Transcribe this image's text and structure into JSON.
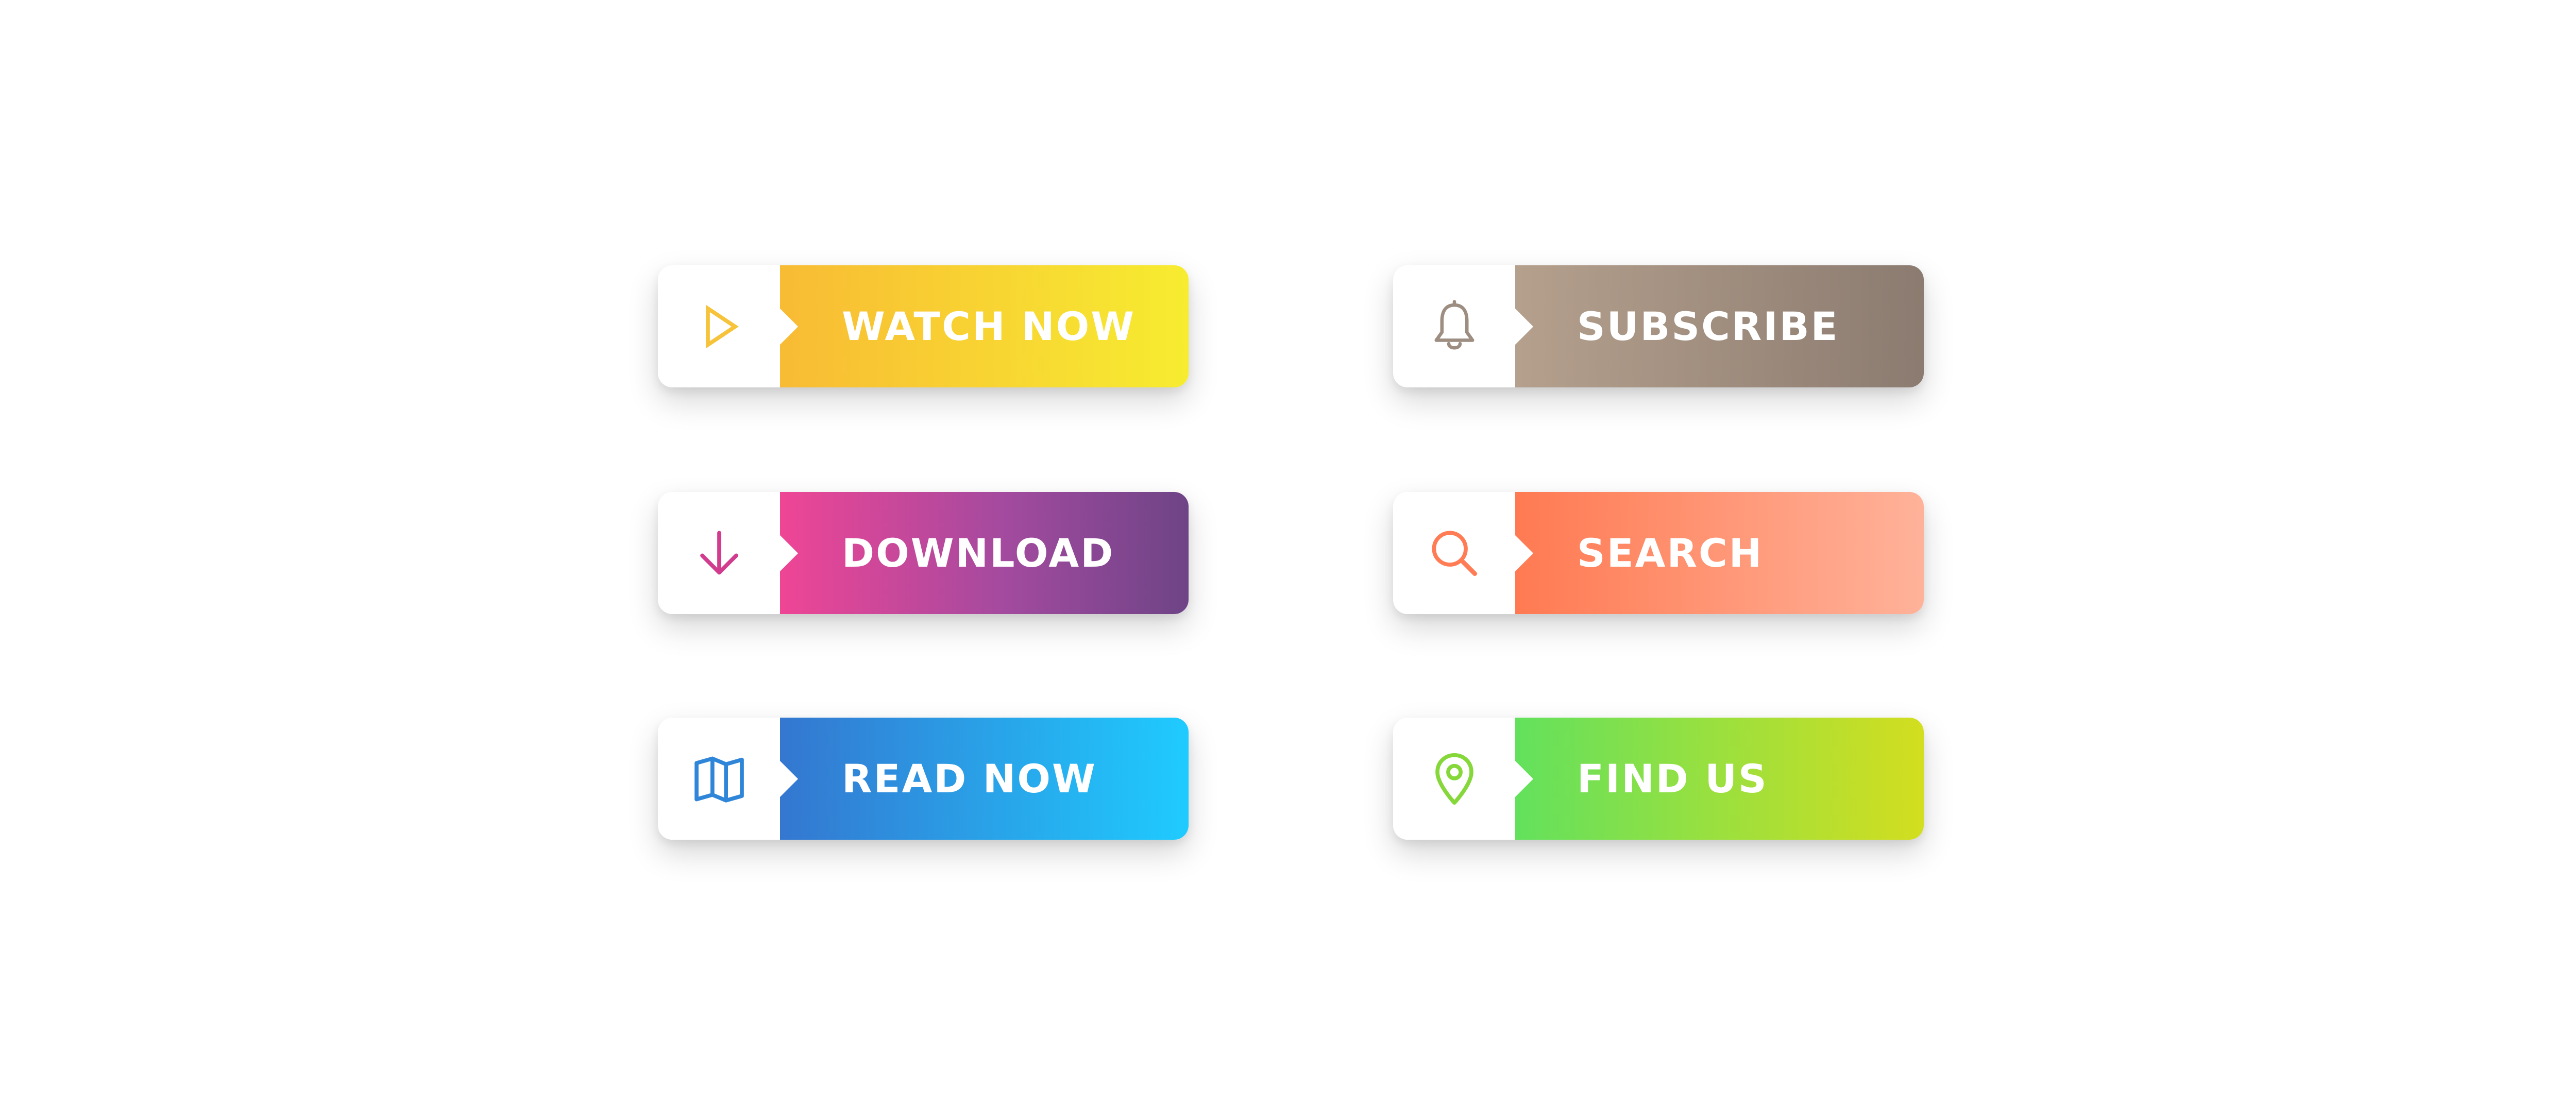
{
  "buttons": {
    "watch_now": {
      "label": "WATCH NOW",
      "icon": "play-icon",
      "gradient_from": "#F8BB34",
      "gradient_to": "#F7EC30",
      "icon_color": "#F6C33A"
    },
    "download": {
      "label": "DOWNLOAD",
      "icon": "arrow-down-icon",
      "gradient_from": "#EF4595",
      "gradient_to": "#6E4486",
      "icon_color": "#D23C8E"
    },
    "read_now": {
      "label": "READ NOW",
      "icon": "book-icon",
      "gradient_from": "#3477D0",
      "gradient_to": "#1FCBFF",
      "icon_color": "#2F86D8"
    },
    "subscribe": {
      "label": "SUBSCRIBE",
      "icon": "bell-icon",
      "gradient_from": "#B5A08D",
      "gradient_to": "#8B7B70",
      "icon_color": "#9E8E82"
    },
    "search": {
      "label": "SEARCH",
      "icon": "search-icon",
      "gradient_from": "#FF7A52",
      "gradient_to": "#FFB29A",
      "icon_color": "#FF7C55"
    },
    "find_us": {
      "label": "FIND US",
      "icon": "location-pin-icon",
      "gradient_from": "#63E15D",
      "gradient_to": "#D3DE1F",
      "icon_color": "#86D83A"
    }
  }
}
